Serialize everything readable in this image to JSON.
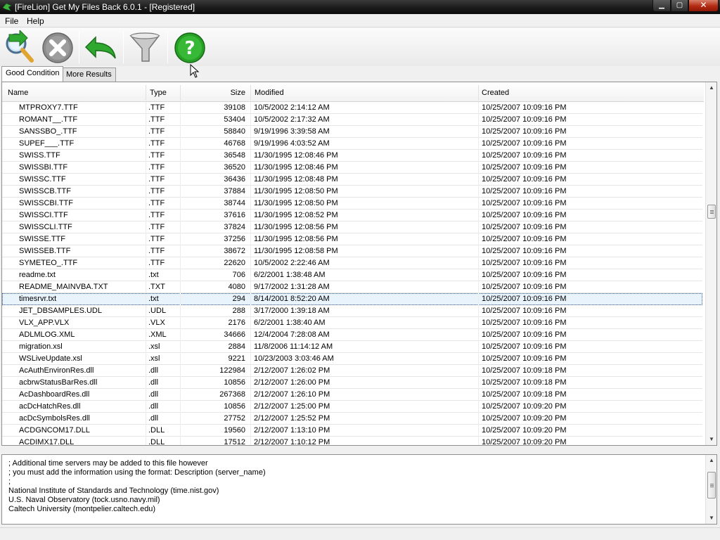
{
  "window": {
    "title": "[FireLion] Get My Files Back 6.0.1 - [Registered]",
    "controls": {
      "minimize": "▁",
      "maximize": "▢",
      "close": "✕"
    }
  },
  "menu": {
    "file": "File",
    "help": "Help"
  },
  "toolbar": {
    "icons": [
      "search-icon",
      "stop-icon",
      "undo-icon",
      "filter-icon",
      "help-icon"
    ],
    "colors": {
      "green": "#2fa82f",
      "gray": "#8c8c8c",
      "help_green": "#26a126"
    }
  },
  "tabs": [
    "Good Condition",
    "More Results"
  ],
  "list": {
    "columns": [
      "Name",
      "Type",
      "Size",
      "Modified",
      "Created"
    ],
    "rows": [
      [
        "MTPROXY7.TTF",
        ".TTF",
        "39108",
        "10/5/2002 2:14:12 AM",
        "10/25/2007 10:09:16 PM"
      ],
      [
        "ROMANT__.TTF",
        ".TTF",
        "53404",
        "10/5/2002 2:17:32 AM",
        "10/25/2007 10:09:16 PM"
      ],
      [
        "SANSSBO_.TTF",
        ".TTF",
        "58840",
        "9/19/1996 3:39:58 AM",
        "10/25/2007 10:09:16 PM"
      ],
      [
        "SUPEF___.TTF",
        ".TTF",
        "46768",
        "9/19/1996 4:03:52 AM",
        "10/25/2007 10:09:16 PM"
      ],
      [
        "SWISS.TTF",
        ".TTF",
        "36548",
        "11/30/1995 12:08:46 PM",
        "10/25/2007 10:09:16 PM"
      ],
      [
        "SWISSBI.TTF",
        ".TTF",
        "36520",
        "11/30/1995 12:08:46 PM",
        "10/25/2007 10:09:16 PM"
      ],
      [
        "SWISSC.TTF",
        ".TTF",
        "36436",
        "11/30/1995 12:08:48 PM",
        "10/25/2007 10:09:16 PM"
      ],
      [
        "SWISSCB.TTF",
        ".TTF",
        "37884",
        "11/30/1995 12:08:50 PM",
        "10/25/2007 10:09:16 PM"
      ],
      [
        "SWISSCBI.TTF",
        ".TTF",
        "38744",
        "11/30/1995 12:08:50 PM",
        "10/25/2007 10:09:16 PM"
      ],
      [
        "SWISSCI.TTF",
        ".TTF",
        "37616",
        "11/30/1995 12:08:52 PM",
        "10/25/2007 10:09:16 PM"
      ],
      [
        "SWISSCLI.TTF",
        ".TTF",
        "37824",
        "11/30/1995 12:08:56 PM",
        "10/25/2007 10:09:16 PM"
      ],
      [
        "SWISSE.TTF",
        ".TTF",
        "37256",
        "11/30/1995 12:08:56 PM",
        "10/25/2007 10:09:16 PM"
      ],
      [
        "SWISSEB.TTF",
        ".TTF",
        "38672",
        "11/30/1995 12:08:58 PM",
        "10/25/2007 10:09:16 PM"
      ],
      [
        "SYMETEO_.TTF",
        ".TTF",
        "22620",
        "10/5/2002 2:22:46 AM",
        "10/25/2007 10:09:16 PM"
      ],
      [
        "readme.txt",
        ".txt",
        "706",
        "6/2/2001 1:38:48 AM",
        "10/25/2007 10:09:16 PM"
      ],
      [
        "README_MAINVBA.TXT",
        ".TXT",
        "4080",
        "9/17/2002 1:31:28 AM",
        "10/25/2007 10:09:16 PM"
      ],
      [
        "timesrvr.txt",
        ".txt",
        "294",
        "8/14/2001 8:52:20 AM",
        "10/25/2007 10:09:16 PM"
      ],
      [
        "JET_DBSAMPLES.UDL",
        ".UDL",
        "288",
        "3/17/2000 1:39:18 AM",
        "10/25/2007 10:09:16 PM"
      ],
      [
        "VLX_APP.VLX",
        ".VLX",
        "2176",
        "6/2/2001 1:38:40 AM",
        "10/25/2007 10:09:16 PM"
      ],
      [
        "ADLMLOG.XML",
        ".XML",
        "34666",
        "12/4/2004 7:28:08 AM",
        "10/25/2007 10:09:16 PM"
      ],
      [
        "migration.xsl",
        ".xsl",
        "2884",
        "11/8/2006 11:14:12 AM",
        "10/25/2007 10:09:16 PM"
      ],
      [
        "WSLiveUpdate.xsl",
        ".xsl",
        "9221",
        "10/23/2003 3:03:46 AM",
        "10/25/2007 10:09:16 PM"
      ],
      [
        "AcAuthEnvironRes.dll",
        ".dll",
        "122984",
        "2/12/2007 1:26:02 PM",
        "10/25/2007 10:09:18 PM"
      ],
      [
        "acbrwStatusBarRes.dll",
        ".dll",
        "10856",
        "2/12/2007 1:26:00 PM",
        "10/25/2007 10:09:18 PM"
      ],
      [
        "AcDashboardRes.dll",
        ".dll",
        "267368",
        "2/12/2007 1:26:10 PM",
        "10/25/2007 10:09:18 PM"
      ],
      [
        "acDcHatchRes.dll",
        ".dll",
        "10856",
        "2/12/2007 1:25:00 PM",
        "10/25/2007 10:09:20 PM"
      ],
      [
        "acDcSymbolsRes.dll",
        ".dll",
        "27752",
        "2/12/2007 1:25:52 PM",
        "10/25/2007 10:09:20 PM"
      ],
      [
        "ACDGNCOM17.DLL",
        ".DLL",
        "19560",
        "2/12/2007 1:13:10 PM",
        "10/25/2007 10:09:20 PM"
      ],
      [
        "ACDIMX17.DLL",
        ".DLL",
        "17512",
        "2/12/2007 1:10:12 PM",
        "10/25/2007 10:09:20 PM"
      ]
    ],
    "selected_index": 16
  },
  "detail": {
    "lines": [
      "; Additional time servers may be added to this file however",
      "; you must add the information using the format: Description (server_name)",
      ";",
      "National Institute of Standards and Technology (time.nist.gov)",
      "U.S. Naval Observatory (tock.usno.navy.mil)",
      "Caltech University (montpelier.caltech.edu)"
    ]
  },
  "scroll": {
    "list_position": 0.34,
    "detail_position": 0.3
  }
}
